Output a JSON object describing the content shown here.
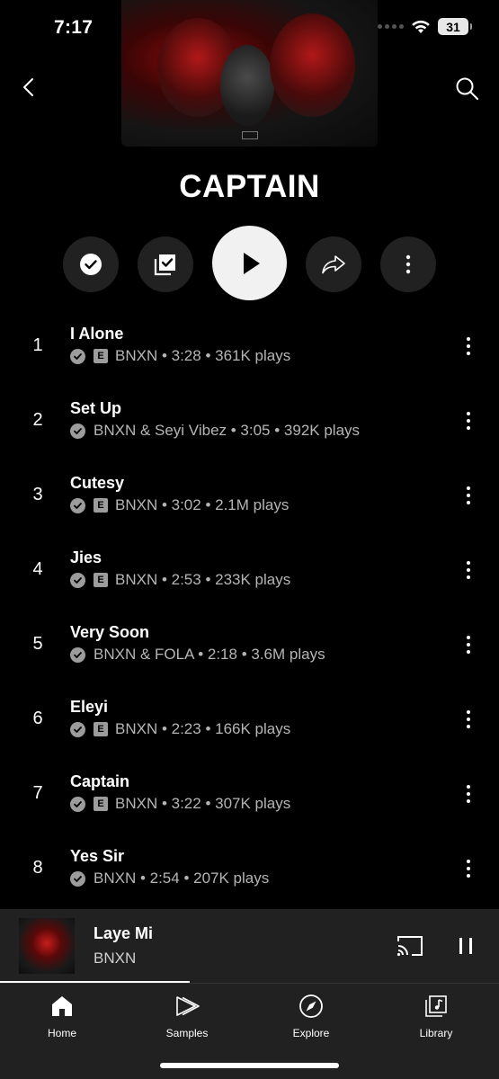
{
  "status_bar": {
    "time": "7:17",
    "battery": "31"
  },
  "album": {
    "title": "CAPTAIN"
  },
  "tracks": [
    {
      "number": "1",
      "title": "I Alone",
      "explicit": true,
      "meta": "BNXN • 3:28 • 361K plays"
    },
    {
      "number": "2",
      "title": "Set Up",
      "explicit": false,
      "meta": "BNXN & Seyi Vibez • 3:05 • 392K plays"
    },
    {
      "number": "3",
      "title": "Cutesy",
      "explicit": true,
      "meta": "BNXN • 3:02 • 2.1M plays"
    },
    {
      "number": "4",
      "title": "Jies",
      "explicit": true,
      "meta": "BNXN • 2:53 • 233K plays"
    },
    {
      "number": "5",
      "title": "Very Soon",
      "explicit": false,
      "meta": "BNXN & FOLA • 2:18 • 3.6M plays"
    },
    {
      "number": "6",
      "title": "Eleyi",
      "explicit": true,
      "meta": "BNXN • 2:23 • 166K plays"
    },
    {
      "number": "7",
      "title": "Captain",
      "explicit": true,
      "meta": "BNXN • 3:22 • 307K plays"
    },
    {
      "number": "8",
      "title": "Yes Sir",
      "explicit": false,
      "meta": "BNXN • 2:54 • 207K plays"
    }
  ],
  "explicit_label": "E",
  "now_playing": {
    "title": "Laye Mi",
    "artist": "BNXN",
    "progress": 0.38
  },
  "nav": {
    "home": "Home",
    "samples": "Samples",
    "explore": "Explore",
    "library": "Library"
  }
}
